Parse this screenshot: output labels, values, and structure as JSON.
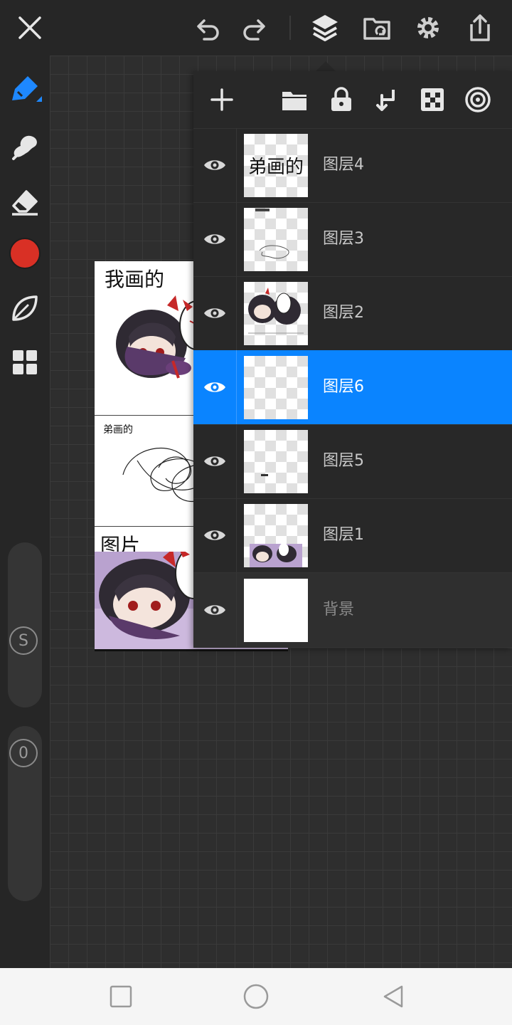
{
  "toolbar": {
    "icons": [
      "close-icon",
      "undo-icon",
      "redo-icon",
      "layers-icon",
      "gallery-icon",
      "settings-icon",
      "share-icon"
    ]
  },
  "tools": {
    "active_tool": "pen",
    "color": "#d93025",
    "icons": [
      "pen-icon",
      "smudge-icon",
      "eraser-icon",
      "color-swatch",
      "fill-leaf-icon",
      "grid-menu-icon"
    ],
    "size_label": "S",
    "opacity_label": "0"
  },
  "layers_panel": {
    "toolbar_icons": [
      "add-icon",
      "folder-icon",
      "lock-icon",
      "merge-down-icon",
      "checker-icon",
      "target-icon"
    ],
    "layers": [
      {
        "name": "图层4",
        "thumb_text": "弟画的",
        "selected": false
      },
      {
        "name": "图层3",
        "thumb_text": "",
        "selected": false
      },
      {
        "name": "图层2",
        "thumb_text": "",
        "selected": false
      },
      {
        "name": "图层6",
        "thumb_text": "",
        "selected": true
      },
      {
        "name": "图层5",
        "thumb_text": "",
        "selected": false
      },
      {
        "name": "图层1",
        "thumb_text": "",
        "selected": false
      },
      {
        "name": "背景",
        "thumb_text": "",
        "selected": false
      }
    ],
    "selected_color": "#0a84ff"
  },
  "artboard": {
    "top_text": "我画的",
    "middle_text": "弟画的",
    "bottom_text": "图片"
  },
  "navbar": {
    "icons": [
      "recents-icon",
      "home-icon",
      "back-icon"
    ]
  }
}
